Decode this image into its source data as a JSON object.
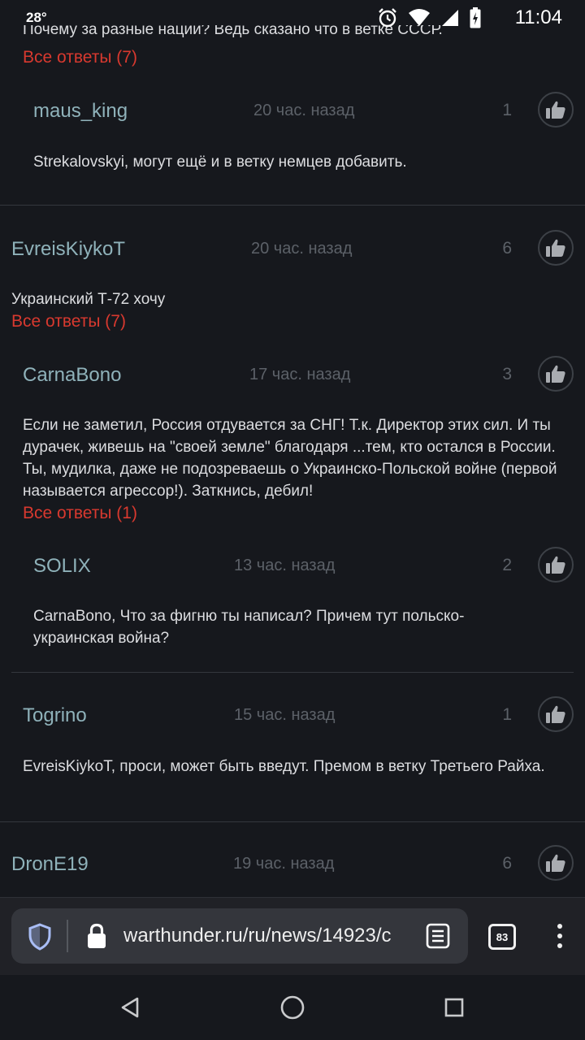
{
  "status_bar": {
    "temperature": "28°",
    "time": "11:04"
  },
  "reply_label": "Все ответы",
  "top_partial": {
    "text": "Почему за разные нации? Ведь сказано что в ветке СССР.",
    "replies": "Все ответы (7)"
  },
  "comments": [
    {
      "user": "maus_king",
      "time": "20 час. назад",
      "likes": "1",
      "text": "Strekalovskyi, могут ещё и в ветку немцев добавить."
    },
    {
      "user": "EvreisKiykoT",
      "time": "20 час. назад",
      "likes": "6",
      "text": "Украинский Т-72 хочу",
      "replies": "Все ответы (7)"
    },
    {
      "user": "CarnaBono",
      "time": "17 час. назад",
      "likes": "3",
      "text": "Если не заметил, Россия отдувается за СНГ! Т.к. Директор этих сил. И ты дурачек, живешь на \"своей земле\" благодаря ...тем, кто остался в России. Ты, мудилка, даже не подозреваешь о Украинско-Польской войне (первой называется агрессор!). Заткнись, дебил!",
      "replies": "Все ответы (1)"
    },
    {
      "user": "SOLIX",
      "time": "13 час. назад",
      "likes": "2",
      "text": "CarnaBono, Что за фигню ты написал? Причем тут польско-украинская война?"
    },
    {
      "user": "Togrino",
      "time": "15 час. назад",
      "likes": "1",
      "text": "EvreisKiykoT, проси, может быть введут. Премом в ветку Третьего Райха."
    },
    {
      "user": "DronE19",
      "time": "19 час. назад",
      "likes": "6"
    }
  ],
  "browser": {
    "url": "warthunder.ru/ru/news/14923/c",
    "tab_count": "83"
  },
  "icons": {
    "like": "thumbs-up-icon",
    "shield": "shield-icon",
    "lock": "lock-icon",
    "reader": "reader-mode-icon",
    "menu": "more-vert-icon",
    "back": "back-triangle-icon",
    "home": "home-circle-icon",
    "recents": "recents-square-icon"
  },
  "colors": {
    "background": "#16181d",
    "username": "#8fb2ba",
    "replies_link": "#d8392f",
    "muted": "#5c6168"
  }
}
